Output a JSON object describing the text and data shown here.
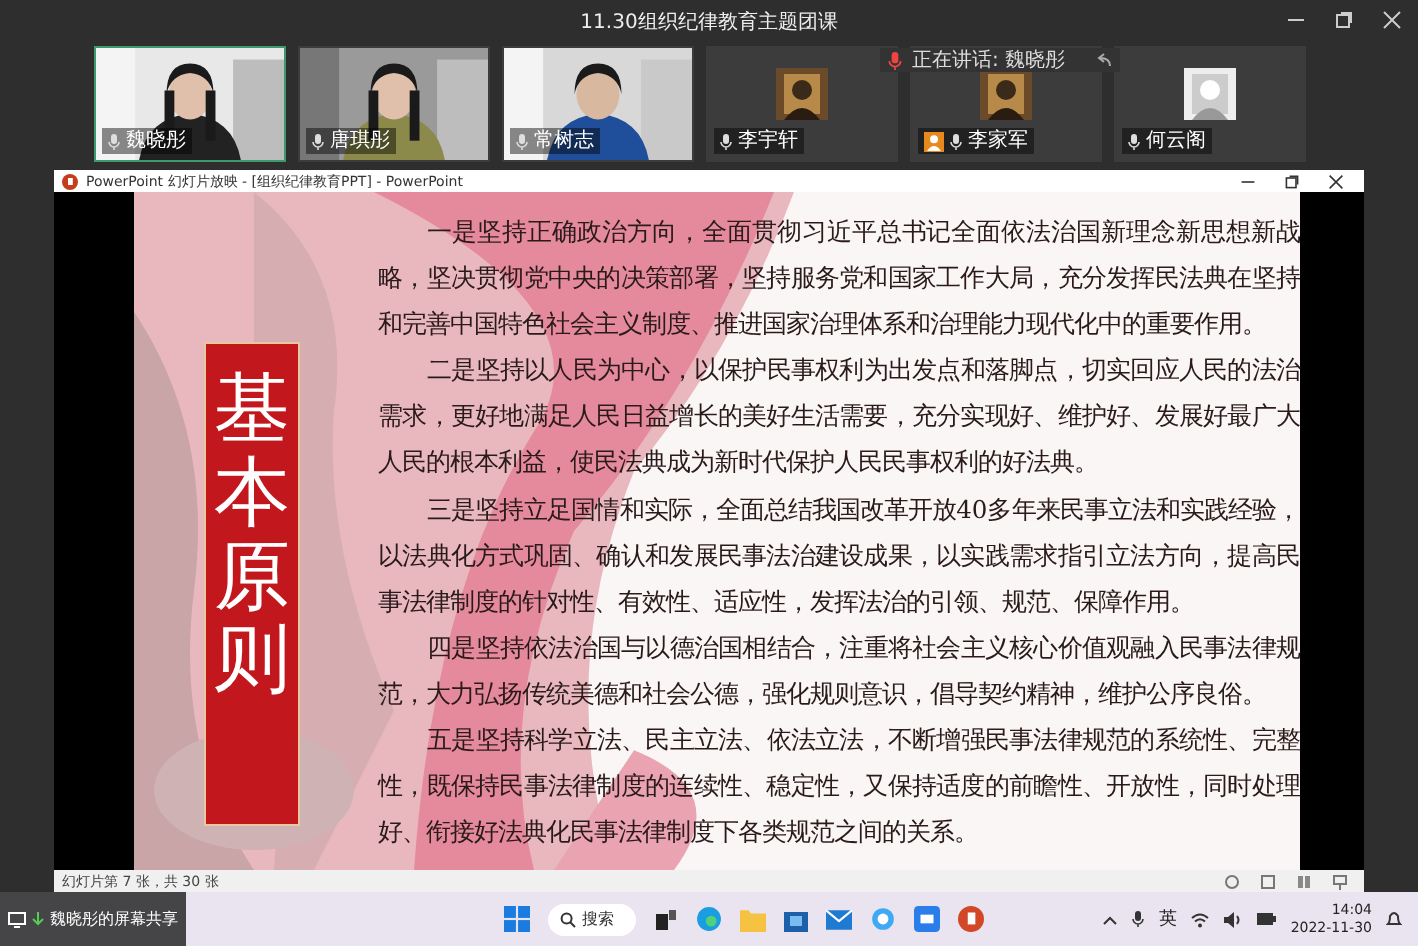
{
  "window": {
    "title": "11.30组织纪律教育主题团课"
  },
  "speaking_banner": "正在讲话: 魏晓彤",
  "participants": [
    {
      "name": "魏晓彤",
      "kind": "video",
      "speaking": true,
      "host": false
    },
    {
      "name": "唐琪彤",
      "kind": "video",
      "speaking": false,
      "host": false
    },
    {
      "name": "常树志",
      "kind": "video",
      "speaking": false,
      "host": false
    },
    {
      "name": "李宇轩",
      "kind": "avatar",
      "speaking": false,
      "host": false
    },
    {
      "name": "李家军",
      "kind": "avatar",
      "speaking": false,
      "host": true
    },
    {
      "name": "何云阁",
      "kind": "avatar",
      "speaking": false,
      "host": false
    }
  ],
  "presentation": {
    "title": "PowerPoint 幻灯片放映 - [组织纪律教育PPT] - PowerPoint",
    "heading": "基本原则",
    "paragraphs": [
      "一是坚持正确政治方向，全面贯彻习近平总书记全面依法治国新理念新思想新战略，坚决贯彻党中央的决策部署，坚持服务党和国家工作大局，充分发挥民法典在坚持和完善中国特色社会主义制度、推进国家治理体系和治理能力现代化中的重要作用。",
      "二是坚持以人民为中心，以保护民事权利为出发点和落脚点，切实回应人民的法治需求，更好地满足人民日益增长的美好生活需要，充分实现好、维护好、发展好最广大人民的根本利益，使民法典成为新时代保护人民民事权利的好法典。",
      "三是坚持立足国情和实际，全面总结我国改革开放40多年来民事立法和实践经验，以法典化方式巩固、确认和发展民事法治建设成果，以实践需求指引立法方向，提高民事法律制度的针对性、有效性、适应性，发挥法治的引领、规范、保障作用。",
      "四是坚持依法治国与以德治国相结合，注重将社会主义核心价值观融入民事法律规范，大力弘扬传统美德和社会公德，强化规则意识，倡导契约精神，维护公序良俗。",
      "五是坚持科学立法、民主立法、依法立法，不断增强民事法律规范的系统性、完整性，既保持民事法律制度的连续性、稳定性，又保持适度的前瞻性、开放性，同时处理好、衔接好法典化民事法律制度下各类规范之间的关系。"
    ],
    "status": "幻灯片第 7 张，共 30 张"
  },
  "taskbar": {
    "search_placeholder": "搜索",
    "ime": "英",
    "time": "14:04",
    "date": "2022-11-30",
    "share_label": "魏晓彤的屏幕共享"
  }
}
